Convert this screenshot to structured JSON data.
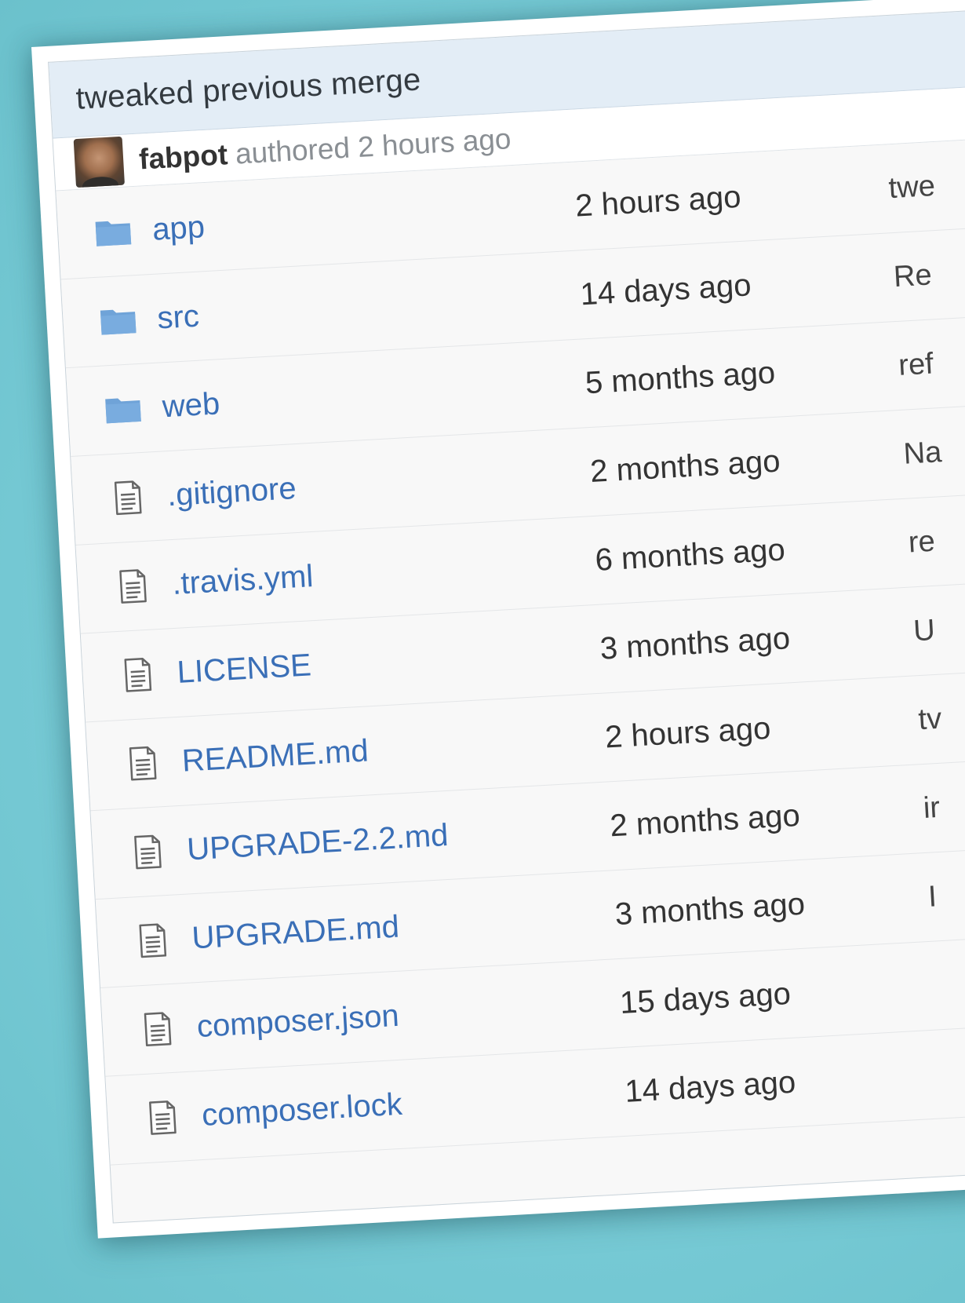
{
  "commit": {
    "title": "tweaked previous merge",
    "author": "fabpot",
    "authored_text": "authored 2 hours ago"
  },
  "files": [
    {
      "type": "folder",
      "icon": "folder-icon",
      "name": "app",
      "age": "2 hours ago",
      "message": "twe"
    },
    {
      "type": "folder",
      "icon": "folder-icon",
      "name": "src",
      "age": "14 days ago",
      "message": "Re"
    },
    {
      "type": "folder",
      "icon": "folder-icon",
      "name": "web",
      "age": "5 months ago",
      "message": "ref"
    },
    {
      "type": "file",
      "icon": "file-icon",
      "name": ".gitignore",
      "age": "2 months ago",
      "message": "Na"
    },
    {
      "type": "file",
      "icon": "file-icon",
      "name": ".travis.yml",
      "age": "6 months ago",
      "message": "re"
    },
    {
      "type": "file",
      "icon": "file-icon",
      "name": "LICENSE",
      "age": "3 months ago",
      "message": "U"
    },
    {
      "type": "file",
      "icon": "file-icon",
      "name": "README.md",
      "age": "2 hours ago",
      "message": "tv"
    },
    {
      "type": "file",
      "icon": "file-icon",
      "name": "UPGRADE-2.2.md",
      "age": "2 months ago",
      "message": "ir"
    },
    {
      "type": "file",
      "icon": "file-icon",
      "name": "UPGRADE.md",
      "age": "3 months ago",
      "message": "I"
    },
    {
      "type": "file",
      "icon": "file-icon",
      "name": "composer.json",
      "age": "15 days ago",
      "message": ""
    },
    {
      "type": "file",
      "icon": "file-icon",
      "name": "composer.lock",
      "age": "14 days ago",
      "message": ""
    }
  ],
  "colors": {
    "link": "#3a6fb7",
    "folder": "#6fa3d8",
    "header_bg": "#e3edf6",
    "background": "#7fcfd9"
  }
}
